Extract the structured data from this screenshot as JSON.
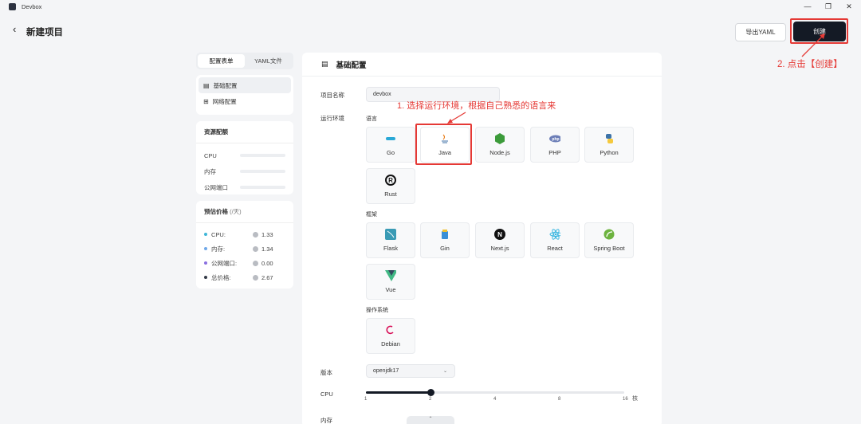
{
  "window": {
    "title": "Devbox",
    "controls": [
      "—",
      "❐",
      "✕"
    ]
  },
  "header": {
    "back_icon": "‹",
    "title": "新建项目",
    "export_label": "导出YAML",
    "create_label": "创建"
  },
  "annotations": {
    "step1": "1. 选择运行环境，根据自己熟悉的语言来",
    "step2": "2. 点击【创建】"
  },
  "sidebar": {
    "tabs": [
      "配置表单",
      "YAML文件"
    ],
    "nav": [
      {
        "label": "基础配置",
        "icon": "document-icon",
        "active": true
      },
      {
        "label": "网络配置",
        "icon": "network-icon",
        "active": false
      }
    ],
    "resources": {
      "title": "资源配额",
      "rows": [
        "CPU",
        "内存",
        "公网端口"
      ]
    },
    "price": {
      "title": "预估价格",
      "unit": "(/天)",
      "rows": [
        {
          "label": "CPU:",
          "value": "1.33",
          "color": "#3fb6d8"
        },
        {
          "label": "内存:",
          "value": "1.34",
          "color": "#6fa8e8"
        },
        {
          "label": "公网端口:",
          "value": "0.00",
          "color": "#8a6fe0"
        },
        {
          "label": "总价格:",
          "value": "2.67",
          "color": "#333a48"
        }
      ]
    }
  },
  "main": {
    "section_title": "基础配置",
    "project_name_label": "项目名称",
    "project_name_value": "devbox",
    "runtime_label": "运行环境",
    "language_label": "语言",
    "languages": [
      {
        "name": "Go",
        "icon": "go-icon"
      },
      {
        "name": "Java",
        "icon": "java-icon",
        "selected": true
      },
      {
        "name": "Node.js",
        "icon": "nodejs-icon"
      },
      {
        "name": "PHP",
        "icon": "php-icon"
      },
      {
        "name": "Python",
        "icon": "python-icon"
      },
      {
        "name": "Rust",
        "icon": "rust-icon"
      }
    ],
    "framework_label": "框架",
    "frameworks": [
      {
        "name": "Flask",
        "icon": "flask-icon"
      },
      {
        "name": "Gin",
        "icon": "gin-icon"
      },
      {
        "name": "Next.js",
        "icon": "nextjs-icon"
      },
      {
        "name": "React",
        "icon": "react-icon"
      },
      {
        "name": "Spring Boot",
        "icon": "spring-boot-icon"
      },
      {
        "name": "Vue",
        "icon": "vue-icon"
      }
    ],
    "os_label": "操作系统",
    "os": [
      {
        "name": "Debian",
        "icon": "debian-icon"
      }
    ],
    "version_label": "版本",
    "version_value": "openjdk17",
    "cpu_label": "CPU",
    "cpu_ticks": [
      "1",
      "2",
      "4",
      "8",
      "16"
    ],
    "cpu_value": 2,
    "cpu_unit": "核",
    "memory_label": "内存"
  }
}
